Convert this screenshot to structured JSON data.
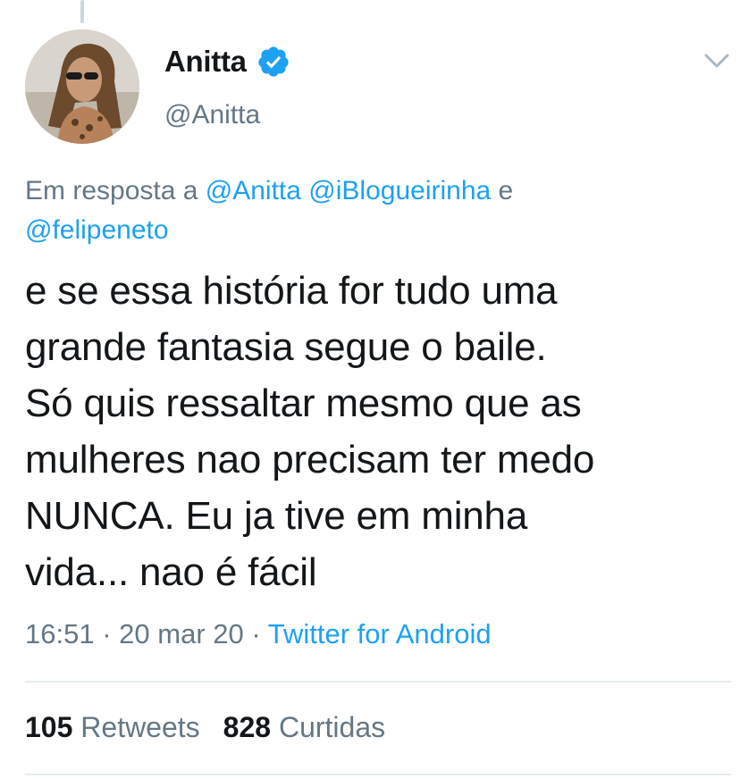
{
  "tweet": {
    "author": {
      "display_name": "Anitta",
      "handle": "@Anitta",
      "verified": true
    },
    "reply_context": {
      "prefix": "Em resposta a",
      "mentions": [
        "@Anitta",
        "@iBlogueirinha"
      ],
      "conjunction": "e",
      "last_mention": "@felipeneto"
    },
    "text_lines": [
      "e se essa história for tudo uma",
      "grande fantasia segue o baile.",
      "Só quis ressaltar mesmo que as",
      "mulheres nao precisam ter medo",
      "NUNCA. Eu ja tive em minha",
      "vida... nao é fácil"
    ],
    "meta": {
      "time": "16:51",
      "date": "20 mar 20",
      "separator": "·",
      "source": "Twitter for Android"
    },
    "stats": {
      "retweets_count": "105",
      "retweets_label": "Retweets",
      "likes_count": "828",
      "likes_label": "Curtidas"
    }
  },
  "icons": {
    "verified": "verified-badge-icon",
    "menu": "chevron-down-icon"
  },
  "colors": {
    "accent": "#1da1f2",
    "secondary_text": "#657786",
    "primary_text": "#14171a",
    "divider": "#e6ecf0"
  }
}
